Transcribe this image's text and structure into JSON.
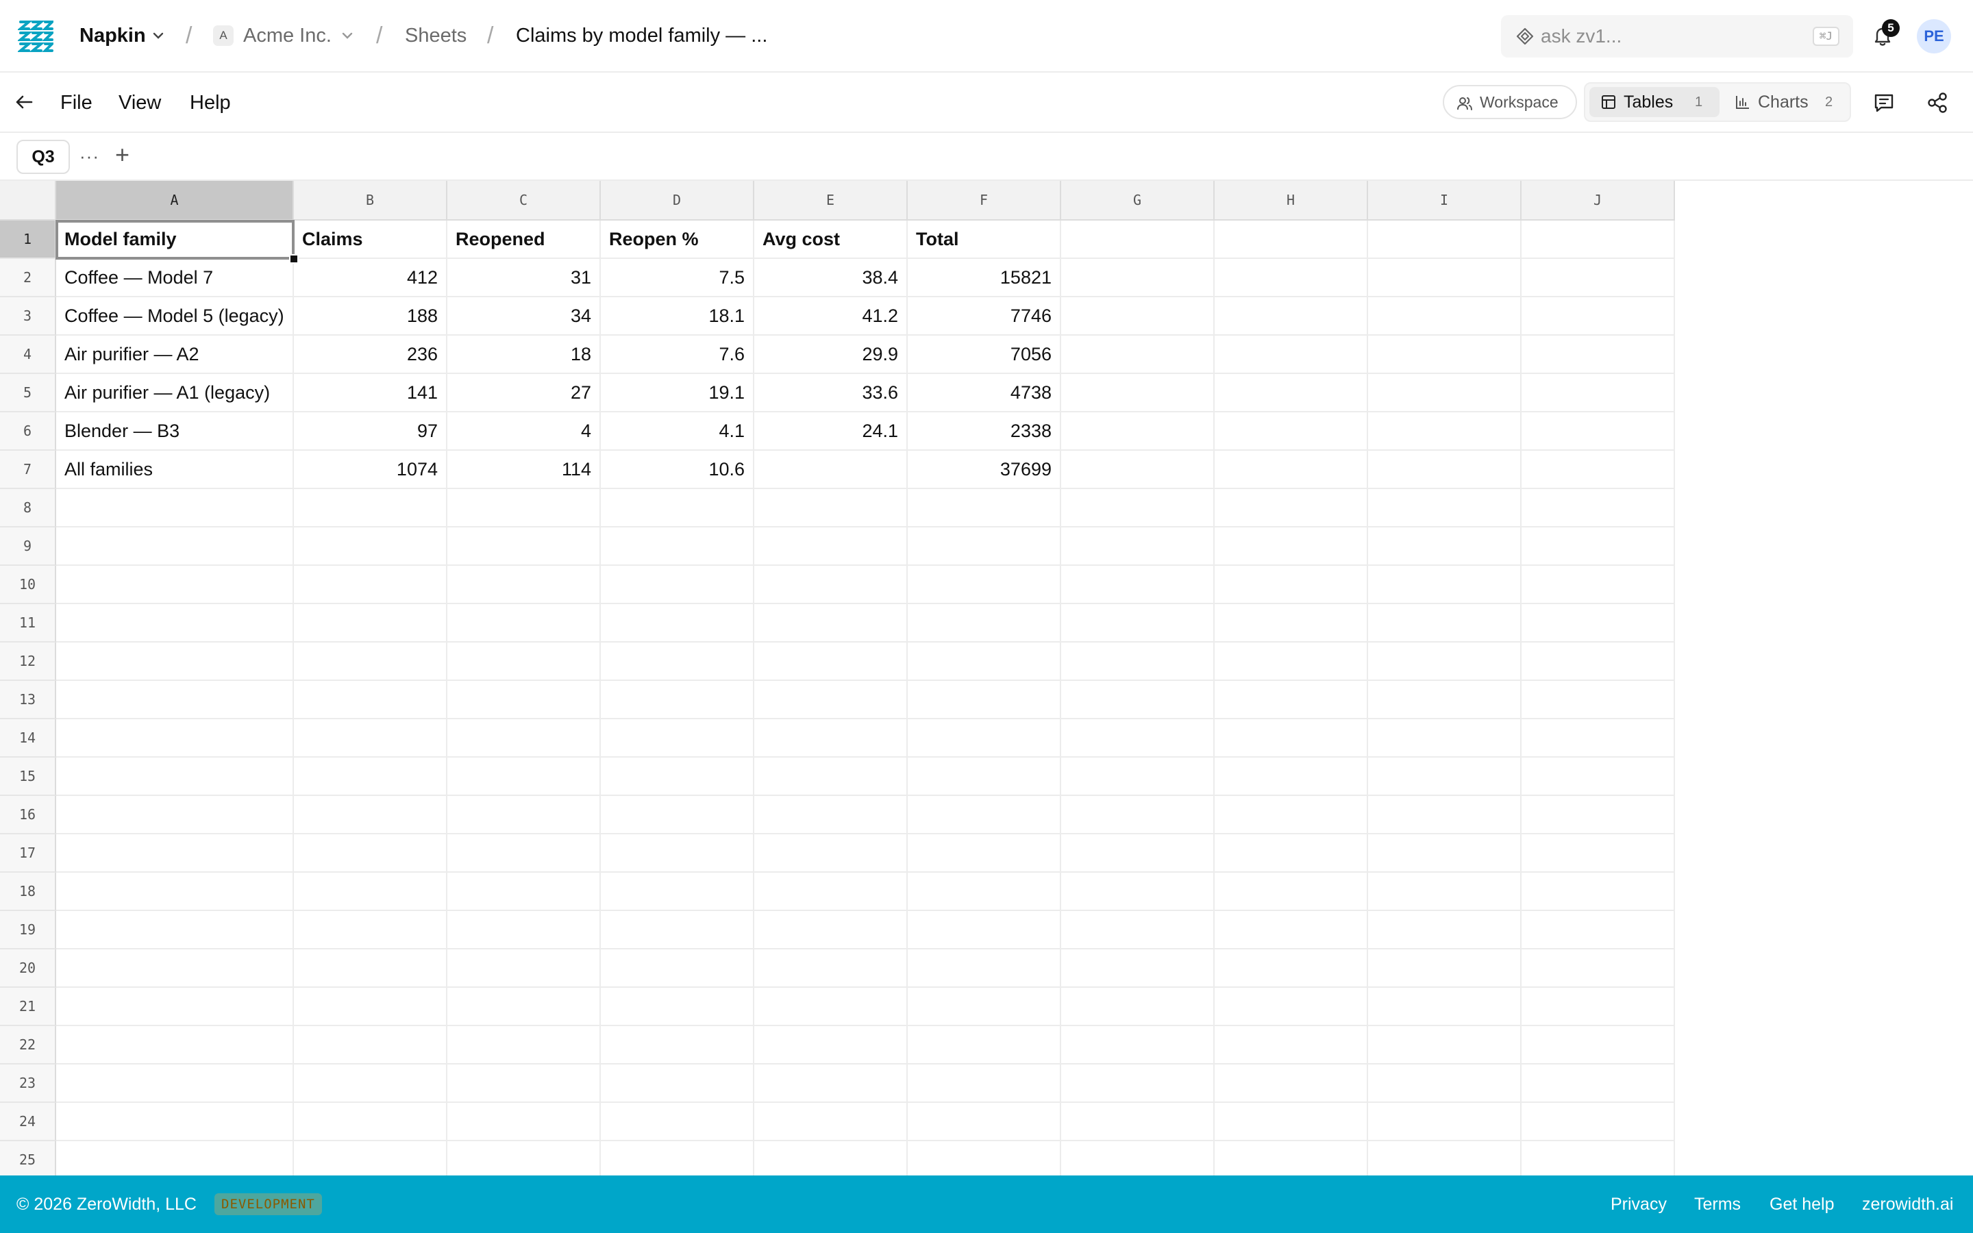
{
  "topbar": {
    "workspace": "Napkin",
    "org_badge": "A",
    "org": "Acme Inc.",
    "section": "Sheets",
    "document": "Claims by model family — ...",
    "ask_placeholder": "ask zv1...",
    "shortcut": "⌘J",
    "notifications": "5",
    "avatar": "PE"
  },
  "menubar": {
    "items": [
      "File",
      "View",
      "Help"
    ],
    "workspace_btn": "Workspace",
    "tabs": [
      {
        "label": "Tables",
        "count": "1"
      },
      {
        "label": "Charts",
        "count": "2"
      }
    ]
  },
  "sheet_tabs": {
    "active": "Q3",
    "more": "···",
    "add": "+"
  },
  "grid": {
    "columns": [
      "A",
      "B",
      "C",
      "D",
      "E",
      "F",
      "G",
      "H",
      "I",
      "J"
    ],
    "row_numbers": [
      "1",
      "2",
      "3",
      "4",
      "5",
      "6",
      "7",
      "8",
      "9",
      "10",
      "11",
      "12",
      "13",
      "14",
      "15",
      "16",
      "17",
      "18",
      "19",
      "20",
      "21",
      "22",
      "23",
      "24",
      "25"
    ],
    "rows": [
      [
        "Model family",
        "Claims",
        "Reopened",
        "Reopen %",
        "Avg cost",
        "Total"
      ],
      [
        "Coffee — Model 7",
        "412",
        "31",
        "7.5",
        "38.4",
        "15821"
      ],
      [
        "Coffee — Model 5 (legacy)",
        "188",
        "34",
        "18.1",
        "41.2",
        "7746"
      ],
      [
        "Air purifier — A2",
        "236",
        "18",
        "7.6",
        "29.9",
        "7056"
      ],
      [
        "Air purifier — A1 (legacy)",
        "141",
        "27",
        "19.1",
        "33.6",
        "4738"
      ],
      [
        "Blender — B3",
        "97",
        "4",
        "4.1",
        "24.1",
        "2338"
      ],
      [
        "All families",
        "1074",
        "114",
        "10.6",
        "",
        "37699"
      ]
    ]
  },
  "footer": {
    "copyright": "© 2026 ZeroWidth, LLC",
    "env": "DEVELOPMENT",
    "links": [
      "Privacy",
      "Terms",
      "Get help",
      "zerowidth.ai"
    ]
  },
  "colors": {
    "footer_bg": "#00a6c9",
    "selected_header": "#c7c7c7",
    "avatar_bg": "#dbe8ff"
  }
}
